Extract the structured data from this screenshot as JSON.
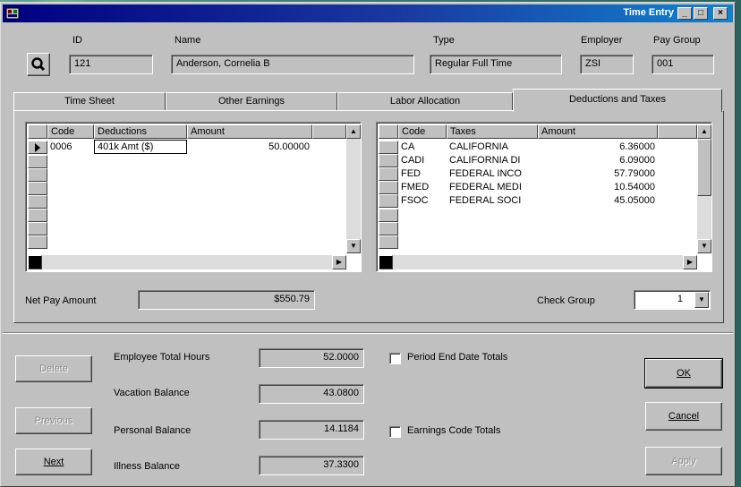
{
  "window": {
    "title": "Time Entry",
    "minimize": "_",
    "maximize": "□",
    "close": "×"
  },
  "header": {
    "id_label": "ID",
    "id_value": "121",
    "name_label": "Name",
    "name_value": "Anderson, Cornelia B",
    "type_label": "Type",
    "type_value": "Regular Full Time",
    "employer_label": "Employer",
    "employer_value": "ZSI",
    "paygroup_label": "Pay Group",
    "paygroup_value": "001"
  },
  "tabs": [
    "Time Sheet",
    "Other Earnings",
    "Labor Allocation",
    "Deductions and Taxes"
  ],
  "active_tab": "Deductions and Taxes",
  "deductions": {
    "columns": [
      "Code",
      "Deductions",
      "Amount"
    ],
    "rows": [
      {
        "code": "0006",
        "deduction": "401k Amt ($)",
        "amount": "50.00000"
      }
    ]
  },
  "taxes": {
    "columns": [
      "Code",
      "Taxes",
      "Amount"
    ],
    "rows": [
      {
        "code": "CA",
        "tax": "CALIFORNIA",
        "amount": "6.36000"
      },
      {
        "code": "CADI",
        "tax": "CALIFORNIA DI",
        "amount": "6.09000"
      },
      {
        "code": "FED",
        "tax": "FEDERAL INCO",
        "amount": "57.79000"
      },
      {
        "code": "FMED",
        "tax": "FEDERAL MEDI",
        "amount": "10.54000"
      },
      {
        "code": "FSOC",
        "tax": "FEDERAL SOCI",
        "amount": "45.05000"
      }
    ]
  },
  "net_pay": {
    "label": "Net Pay Amount",
    "value": "$550.79"
  },
  "check_group": {
    "label": "Check Group",
    "value": "1"
  },
  "summary": {
    "total_hours_label": "Employee Total Hours",
    "total_hours": "52.0000",
    "vacation_label": "Vacation Balance",
    "vacation": "43.0800",
    "personal_label": "Personal Balance",
    "personal": "14.1184",
    "illness_label": "Illness Balance",
    "illness": "37.3300"
  },
  "checkboxes": {
    "period_end": "Period End Date Totals",
    "earnings_code": "Earnings Code Totals"
  },
  "buttons": {
    "delete": "Delete",
    "previous": "Previous",
    "next": "Next",
    "ok": "OK",
    "cancel": "Cancel",
    "apply": "Apply"
  },
  "colors": {
    "title_start": "#000080",
    "title_end": "#1084d0",
    "face": "#c0c0c0"
  }
}
